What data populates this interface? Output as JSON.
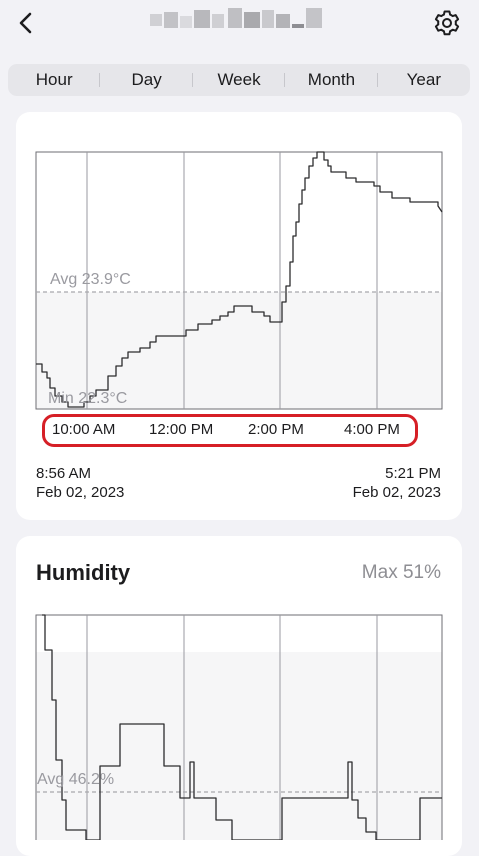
{
  "header": {
    "back_icon": "chevron-left-icon",
    "settings_icon": "gear-icon",
    "title": ""
  },
  "tabs": [
    {
      "label": "Hour"
    },
    {
      "label": "Day"
    },
    {
      "label": "Week"
    },
    {
      "label": "Month"
    },
    {
      "label": "Year"
    }
  ],
  "temperature_card": {
    "avg_label": "Avg 23.9°C",
    "min_label": "Min 22.3°C",
    "time_ticks": [
      "10:00 AM",
      "12:00 PM",
      "2:00 PM",
      "4:00 PM"
    ],
    "start_time": "8:56 AM",
    "start_date": "Feb 02, 2023",
    "end_time": "5:21 PM",
    "end_date": "Feb 02, 2023",
    "highlight_color": "#d61f26"
  },
  "humidity_card": {
    "title": "Humidity",
    "max_label": "Max 51%",
    "avg_label": "Avg 46.2%"
  }
}
